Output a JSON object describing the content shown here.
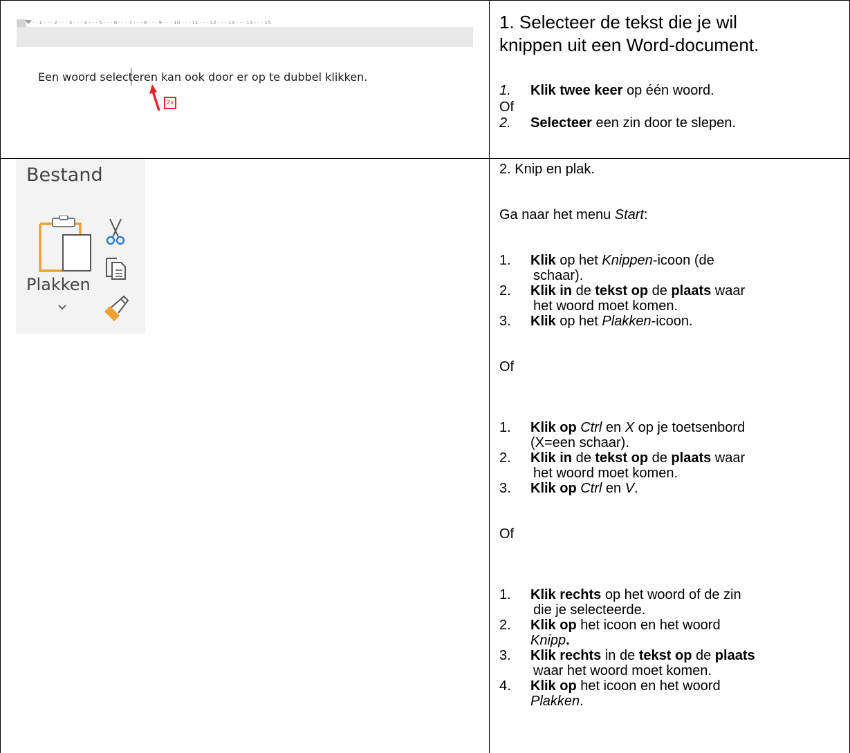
{
  "word_screenshot": {
    "ruler_numbers": [
      "1",
      "2",
      "3",
      "4",
      "5",
      "6",
      "7",
      "8",
      "9",
      "10",
      "11",
      "12",
      "13",
      "14",
      "15"
    ],
    "sentence": "Een woord selecteren kan ook door er op te dubbel klikken.",
    "badge": "2x",
    "accent_color": "#e0242b"
  },
  "ribbon_screenshot": {
    "tab_label": "Bestand",
    "paste_label": "Plakken",
    "icons": [
      "paste-icon",
      "scissors-icon",
      "copy-icon",
      "format-painter-icon",
      "chevron-down-icon"
    ]
  },
  "step1": {
    "title_line1": "1. Selecteer de tekst die je wil",
    "title_line2": "knippen uit een Word-document.",
    "items": [
      {
        "num": "1.",
        "bold": "Klik twee keer",
        "rest": " op één woord."
      },
      {
        "num": "2.",
        "bold": "Selecteer",
        "rest": " een zin door te slepen."
      }
    ],
    "or": "Of"
  },
  "step2": {
    "title": "2. Knip en plak.",
    "intro_prefix": "Ga naar het menu ",
    "intro_menu": "Start",
    "intro_suffix": ":",
    "or": "Of",
    "method1": {
      "i1": {
        "num": "1.",
        "b1": "Klik",
        "t1": " op het ",
        "it1": "Knippen",
        "t2": "-icoon (de",
        "line2": "schaar)."
      },
      "i2": {
        "num": "2.",
        "b1": "Klik in",
        "t1": " de ",
        "b2": "tekst op",
        "t2": " de ",
        "b3": "plaats",
        "t3": " waar",
        "line2": "het woord moet komen."
      },
      "i3": {
        "num": "3.",
        "b1": "Klik",
        "t1": " op het ",
        "it1": "Plakken",
        "t2": "-icoon."
      }
    },
    "method2": {
      "i1": {
        "num": "1.",
        "b1": "Klik op",
        "t0": " ",
        "it1": "Ctrl",
        "t1": " en ",
        "it2": "X",
        "t2": " op je toetsenbord",
        "line2": "(X=een schaar)."
      },
      "i2": {
        "num": "2.",
        "b1": "Klik in",
        "t1": " de ",
        "b2": "tekst op",
        "t2": " de ",
        "b3": "plaats",
        "t3": " waar",
        "line2": "het woord moet komen."
      },
      "i3": {
        "num": "3.",
        "b1": "Klik op",
        "t0": " ",
        "it1": "Ctrl",
        "t1": " en ",
        "it2": "V",
        "t2": "."
      }
    },
    "method3": {
      "i1": {
        "num": "1.",
        "b1": "Klik rechts",
        "t1": " op het woord of de zin",
        "line2": "die je selecteerde."
      },
      "i2": {
        "num": "2.",
        "b1": "Klik op",
        "t1": " het icoon en het woord",
        "line2_it": "Knipp",
        "line2_b": "."
      },
      "i3": {
        "num": "3.",
        "b1": "Klik rechts",
        "t1": " in de ",
        "b2": "tekst op",
        "t2": " de ",
        "b3": "plaats",
        "line2": "waar het woord moet komen."
      },
      "i4": {
        "num": "4.",
        "b1": "Klik op",
        "t1": " het icoon en het woord",
        "line2_it": "Plakken",
        "line2_t": "."
      }
    }
  }
}
